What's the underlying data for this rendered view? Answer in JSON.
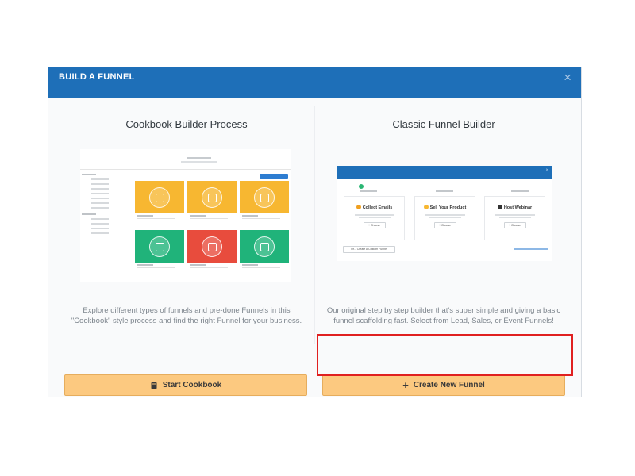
{
  "modal": {
    "title": "BUILD A FUNNEL",
    "close": "×"
  },
  "cookbook": {
    "title": "Cookbook Builder Process",
    "description": "Explore different types of funnels and pre-done Funnels in this \"Cookbook\" style process and find the right Funnel for your business.",
    "button_label": "Start Cookbook",
    "tile_colors": [
      "#f7b731",
      "#f7b731",
      "#f7b731",
      "#20b37a",
      "#e84c3d",
      "#20b37a"
    ]
  },
  "classic": {
    "title": "Classic Funnel Builder",
    "description": "Our original step by step builder that's super simple and giving a basic funnel scaffolding fast. Select from Lead, Sales, or Event Funnels!",
    "button_label": "Create New Funnel",
    "cards": [
      {
        "title": "Collect Emails",
        "icon_color": "#f0a020"
      },
      {
        "title": "Sell Your Product",
        "icon_color": "#f7b731"
      },
      {
        "title": "Host Webinar",
        "icon_color": "#333333"
      }
    ]
  },
  "colors": {
    "header": "#1e6fb8",
    "button_fill": "#fcc980",
    "highlight": "#e02020"
  }
}
